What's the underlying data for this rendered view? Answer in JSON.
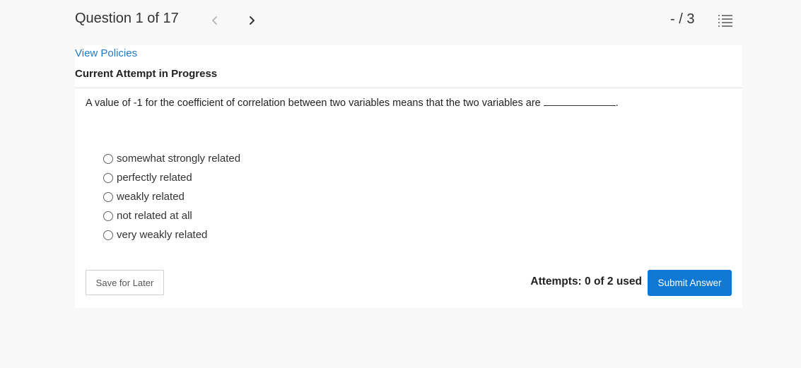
{
  "header": {
    "question_counter": "Question 1 of 17",
    "prev_icon": "chevron-left-icon",
    "next_icon": "chevron-right-icon",
    "score": "- / 3",
    "list_icon": "list-icon"
  },
  "card": {
    "policies_link": "View Policies",
    "attempt_heading": "Current Attempt in Progress",
    "question_text": "A value of -1 for the coefficient of correlation between two variables means that the two variables are",
    "question_end": ".",
    "options": [
      "somewhat strongly related",
      "perfectly related",
      "weakly related",
      "not related at all",
      "very weakly related"
    ],
    "save_label": "Save for Later",
    "attempts_text": "Attempts: 0 of 2 used",
    "submit_label": "Submit Answer"
  },
  "colors": {
    "link": "#1f7ac6",
    "primary_button": "#0f78d4",
    "background": "#f8f8f8"
  }
}
